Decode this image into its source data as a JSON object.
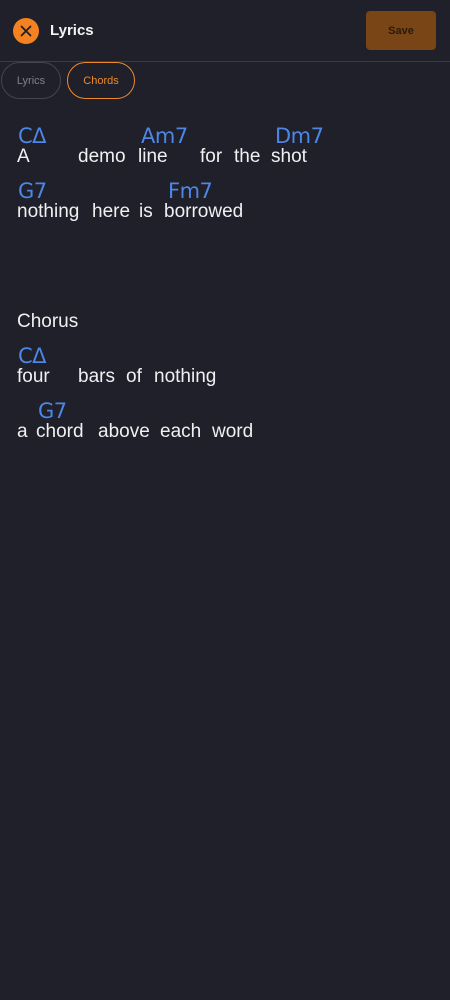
{
  "header": {
    "title": "Lyrics",
    "save_label": "Save",
    "close_icon": "close-icon"
  },
  "tabs": [
    {
      "label": "Lyrics",
      "active": false
    },
    {
      "label": "Chords",
      "active": true
    }
  ],
  "colors": {
    "accent": "#f58220",
    "chord": "#4e86e6",
    "background": "#1f2029"
  },
  "lines": [
    {
      "words": [
        "A",
        "demo",
        "line",
        "for",
        "the",
        "shot"
      ],
      "chords": [
        "CΔ",
        "Am7",
        "Dm7"
      ]
    },
    {
      "words": [
        "nothing",
        "here",
        "is",
        "borrowed"
      ],
      "chords": [
        "G7",
        "Fm7"
      ]
    },
    {
      "section": "Chorus"
    },
    {
      "words": [
        "four",
        "bars",
        "of",
        "nothing"
      ],
      "chords": [
        "CΔ"
      ]
    },
    {
      "words": [
        "a",
        "chord",
        "above",
        "each",
        "word"
      ],
      "chords": [
        "G7"
      ]
    }
  ]
}
